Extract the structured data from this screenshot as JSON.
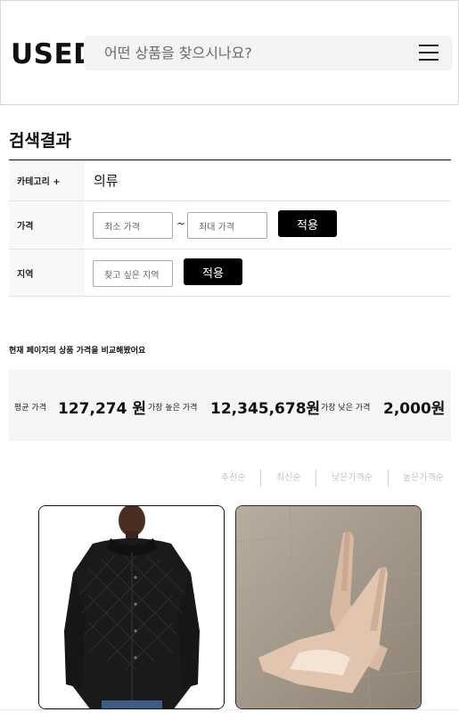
{
  "header": {
    "logo": "USED",
    "search_placeholder": "어떤 상품을 찾으시나요?",
    "menu_icon": "hamburger-menu-icon"
  },
  "results": {
    "title": "검색결과",
    "filters": {
      "category_label": "카테고리 +",
      "category_value": "의류",
      "price_label": "가격",
      "min_price_placeholder": "최소 가격",
      "tilde": "~",
      "max_price_placeholder": "최대 가격",
      "price_apply": "적용",
      "region_label": "지역",
      "region_placeholder": "찾고 싶은 지역",
      "region_apply": "적용"
    }
  },
  "compare": {
    "title": "현재 페이지의 상품 가격을 비교해봤어요",
    "avg_label": "평균 가격",
    "avg_value": "127,274 원",
    "max_label": "가장 높은 가격",
    "max_value": "12,345,678원",
    "min_label": "가장 낮은 가격",
    "min_value": "2,000원"
  },
  "sort": {
    "options": [
      "추천순",
      "최신순",
      "낮은가격순",
      "높은가격순"
    ]
  },
  "products": [
    {
      "image_icon": "black-quilted-jacket-image"
    },
    {
      "image_icon": "beige-high-heels-image"
    }
  ],
  "colors": {
    "accent": "#000000",
    "panel_bg": "#f4f5f7",
    "search_bg": "#f2f3f5",
    "muted_text": "#c3c3c3"
  }
}
